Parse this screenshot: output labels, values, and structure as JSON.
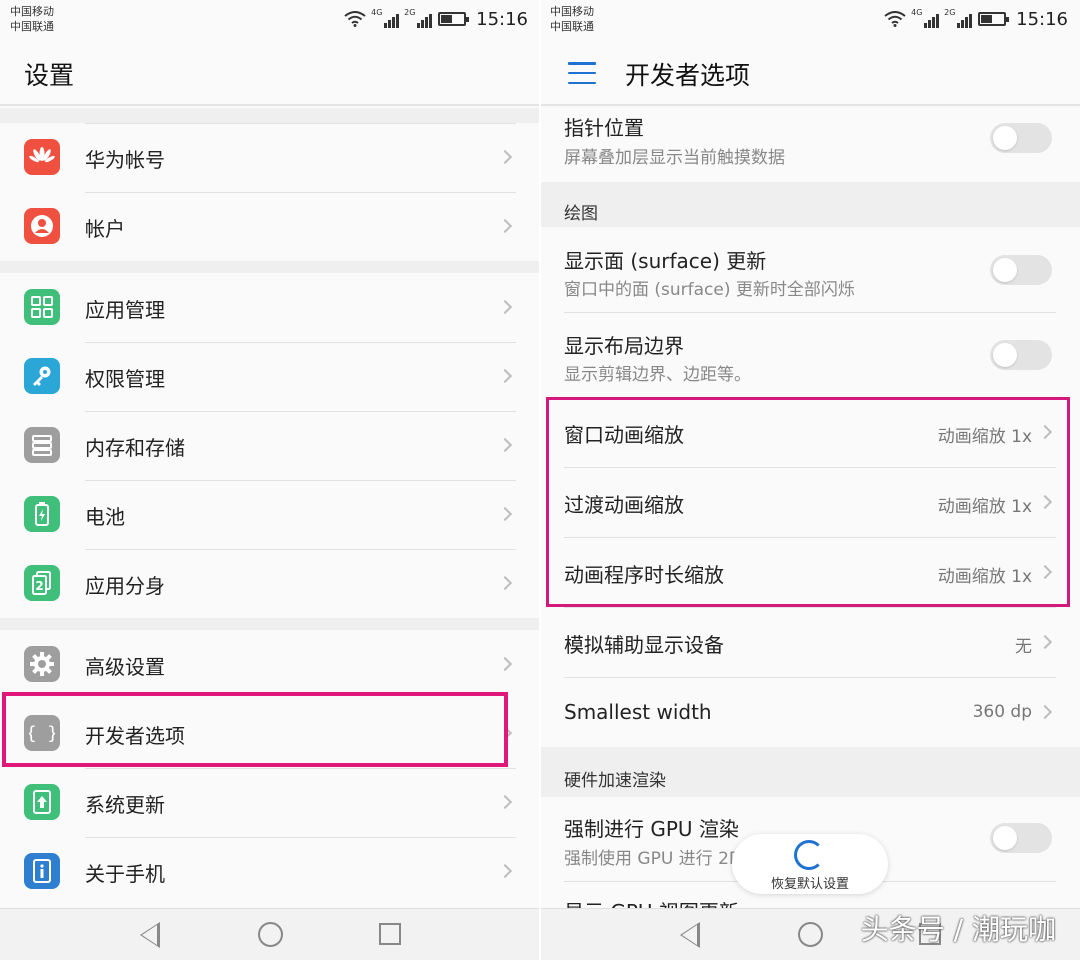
{
  "left": {
    "status": {
      "carrier1": "中国移动",
      "carrier2": "中国联通",
      "net1": "4G",
      "net2": "2G",
      "time": "15:16"
    },
    "title": "设置",
    "items": [
      {
        "label": "华为帐号",
        "icon": "huawei-logo-icon",
        "color": "#f0503f"
      },
      {
        "label": "帐户",
        "icon": "account-icon",
        "color": "#f0503f"
      },
      {
        "label": "应用管理",
        "icon": "apps-grid-icon",
        "color": "#3fbf7a"
      },
      {
        "label": "权限管理",
        "icon": "key-icon",
        "color": "#2aa7d6"
      },
      {
        "label": "内存和存储",
        "icon": "storage-icon",
        "color": "#9e9e9e"
      },
      {
        "label": "电池",
        "icon": "battery-icon",
        "color": "#3fbf7a"
      },
      {
        "label": "应用分身",
        "icon": "app-twin-icon",
        "color": "#3fbf7a"
      },
      {
        "label": "高级设置",
        "icon": "gear-icon",
        "color": "#9e9e9e"
      },
      {
        "label": "开发者选项",
        "icon": "braces-icon",
        "color": "#9e9e9e"
      },
      {
        "label": "系统更新",
        "icon": "update-icon",
        "color": "#3fbf7a"
      },
      {
        "label": "关于手机",
        "icon": "info-icon",
        "color": "#2f7fd1"
      }
    ]
  },
  "right": {
    "status": {
      "carrier1": "中国移动",
      "carrier2": "中国联通",
      "net1": "4G",
      "net2": "2G",
      "time": "15:16"
    },
    "title": "开发者选项",
    "pointer": {
      "title": "指针位置",
      "sub": "屏幕叠加层显示当前触摸数据"
    },
    "section_drawing": "绘图",
    "surface": {
      "title": "显示面 (surface) 更新",
      "sub": "窗口中的面 (surface) 更新时全部闪烁"
    },
    "layout": {
      "title": "显示布局边界",
      "sub": "显示剪辑边界、边距等。"
    },
    "window_anim": {
      "title": "窗口动画缩放",
      "value": "动画缩放 1x"
    },
    "transition_anim": {
      "title": "过渡动画缩放",
      "value": "动画缩放 1x"
    },
    "animator_dur": {
      "title": "动画程序时长缩放",
      "value": "动画缩放 1x"
    },
    "simulate_display": {
      "title": "模拟辅助显示设备",
      "value": "无"
    },
    "smallest_width": {
      "title": "Smallest width",
      "value": "360 dp"
    },
    "section_hw": "硬件加速渲染",
    "force_gpu": {
      "title": "强制进行 GPU 渲染",
      "sub": "强制使用 GPU 进行 2D 绘"
    },
    "gpu_view_partial": "显示 GPU 视图更新",
    "restore": "恢复默认设置",
    "watermark": "头条号 / 潮玩咖"
  },
  "colors": {
    "accent": "#1f72d1",
    "highlight": "#e0187b"
  }
}
